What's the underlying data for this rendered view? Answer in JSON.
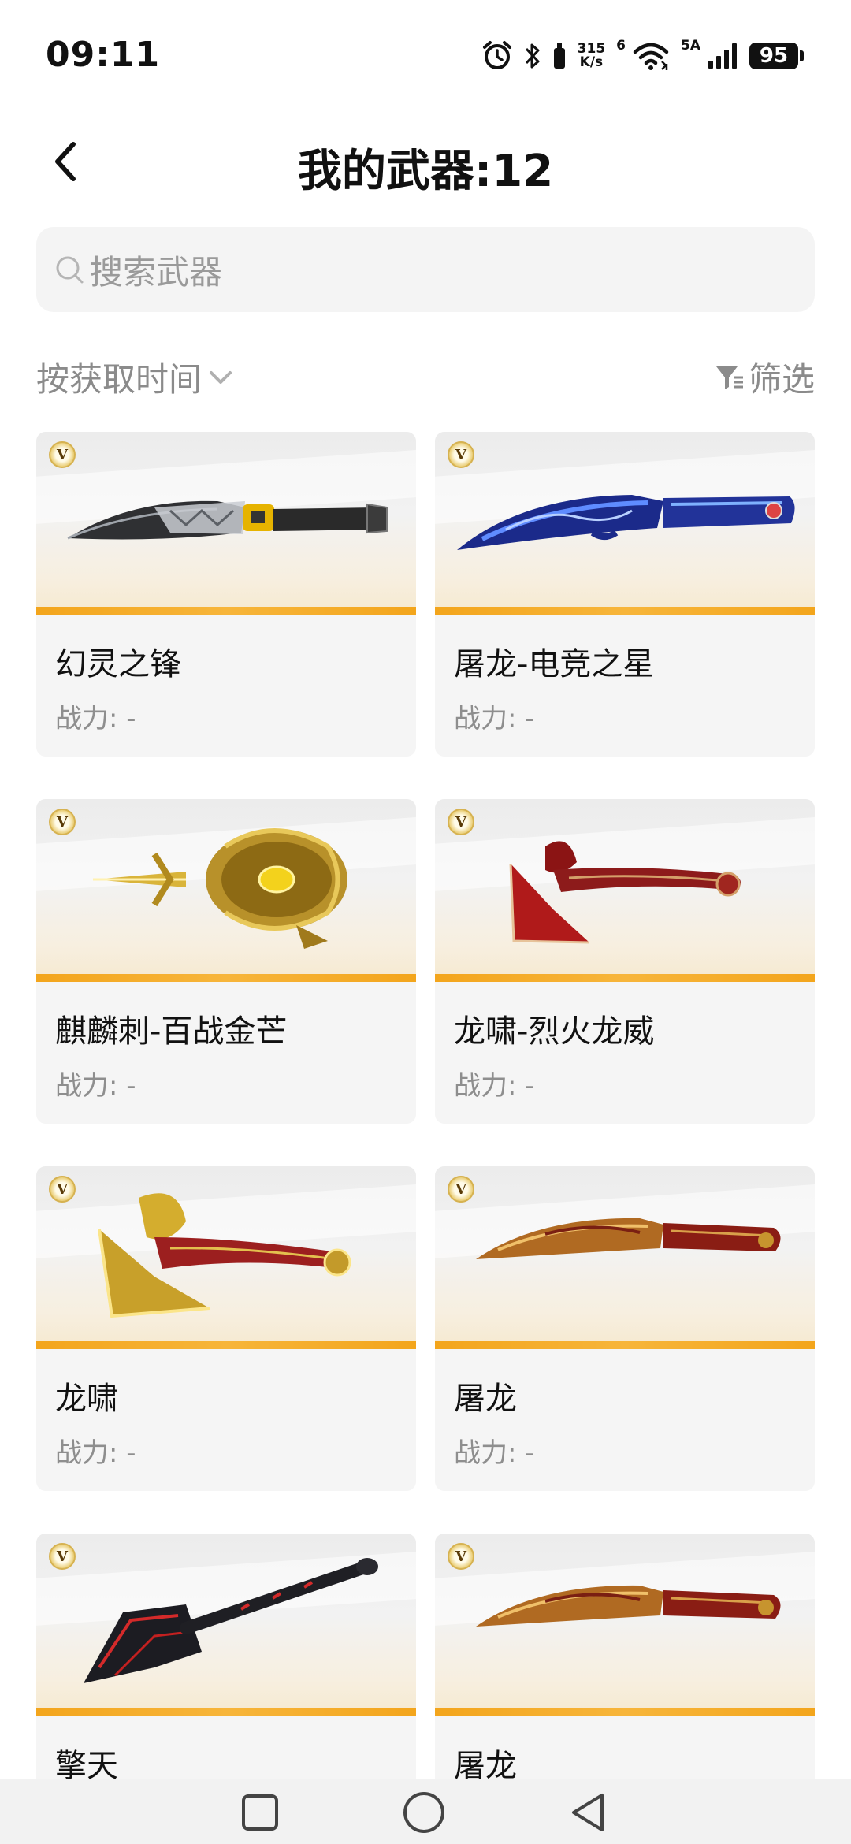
{
  "status_bar": {
    "time": "09:11",
    "net_speed_value": "315",
    "net_speed_unit": "K/s",
    "wifi_label": "6",
    "signal_label": "5A",
    "battery": "95"
  },
  "header": {
    "title": "我的武器:12"
  },
  "search": {
    "placeholder": "搜索武器"
  },
  "filters": {
    "sort_label": "按获取时间",
    "filter_label": "筛选"
  },
  "colors": {
    "accent_orange": "#f3a51c",
    "card_bg": "#f5f5f5",
    "muted_text": "#8e8e8e"
  },
  "weapons": [
    {
      "name": "幻灵之锋",
      "power": "战力: -",
      "badge": "V",
      "icon": "kukri-silver-icon"
    },
    {
      "name": "屠龙-电竞之星",
      "power": "战力: -",
      "badge": "V",
      "icon": "kukri-blue-icon"
    },
    {
      "name": "麒麟刺-百战金芒",
      "power": "战力: -",
      "badge": "V",
      "icon": "gold-dagger-icon"
    },
    {
      "name": "龙啸-烈火龙威",
      "power": "战力: -",
      "badge": "V",
      "icon": "red-axe-icon"
    },
    {
      "name": "龙啸",
      "power": "战力: -",
      "badge": "V",
      "icon": "gold-axe-icon"
    },
    {
      "name": "屠龙",
      "power": "战力: -",
      "badge": "V",
      "icon": "kukri-red-icon"
    },
    {
      "name": "擎天",
      "power": "",
      "badge": "V",
      "icon": "black-shovel-icon"
    },
    {
      "name": "屠龙",
      "power": "",
      "badge": "V",
      "icon": "kukri-red-icon"
    }
  ],
  "nav": {
    "recent": "square-icon",
    "home": "circle-icon",
    "back": "triangle-back-icon"
  }
}
